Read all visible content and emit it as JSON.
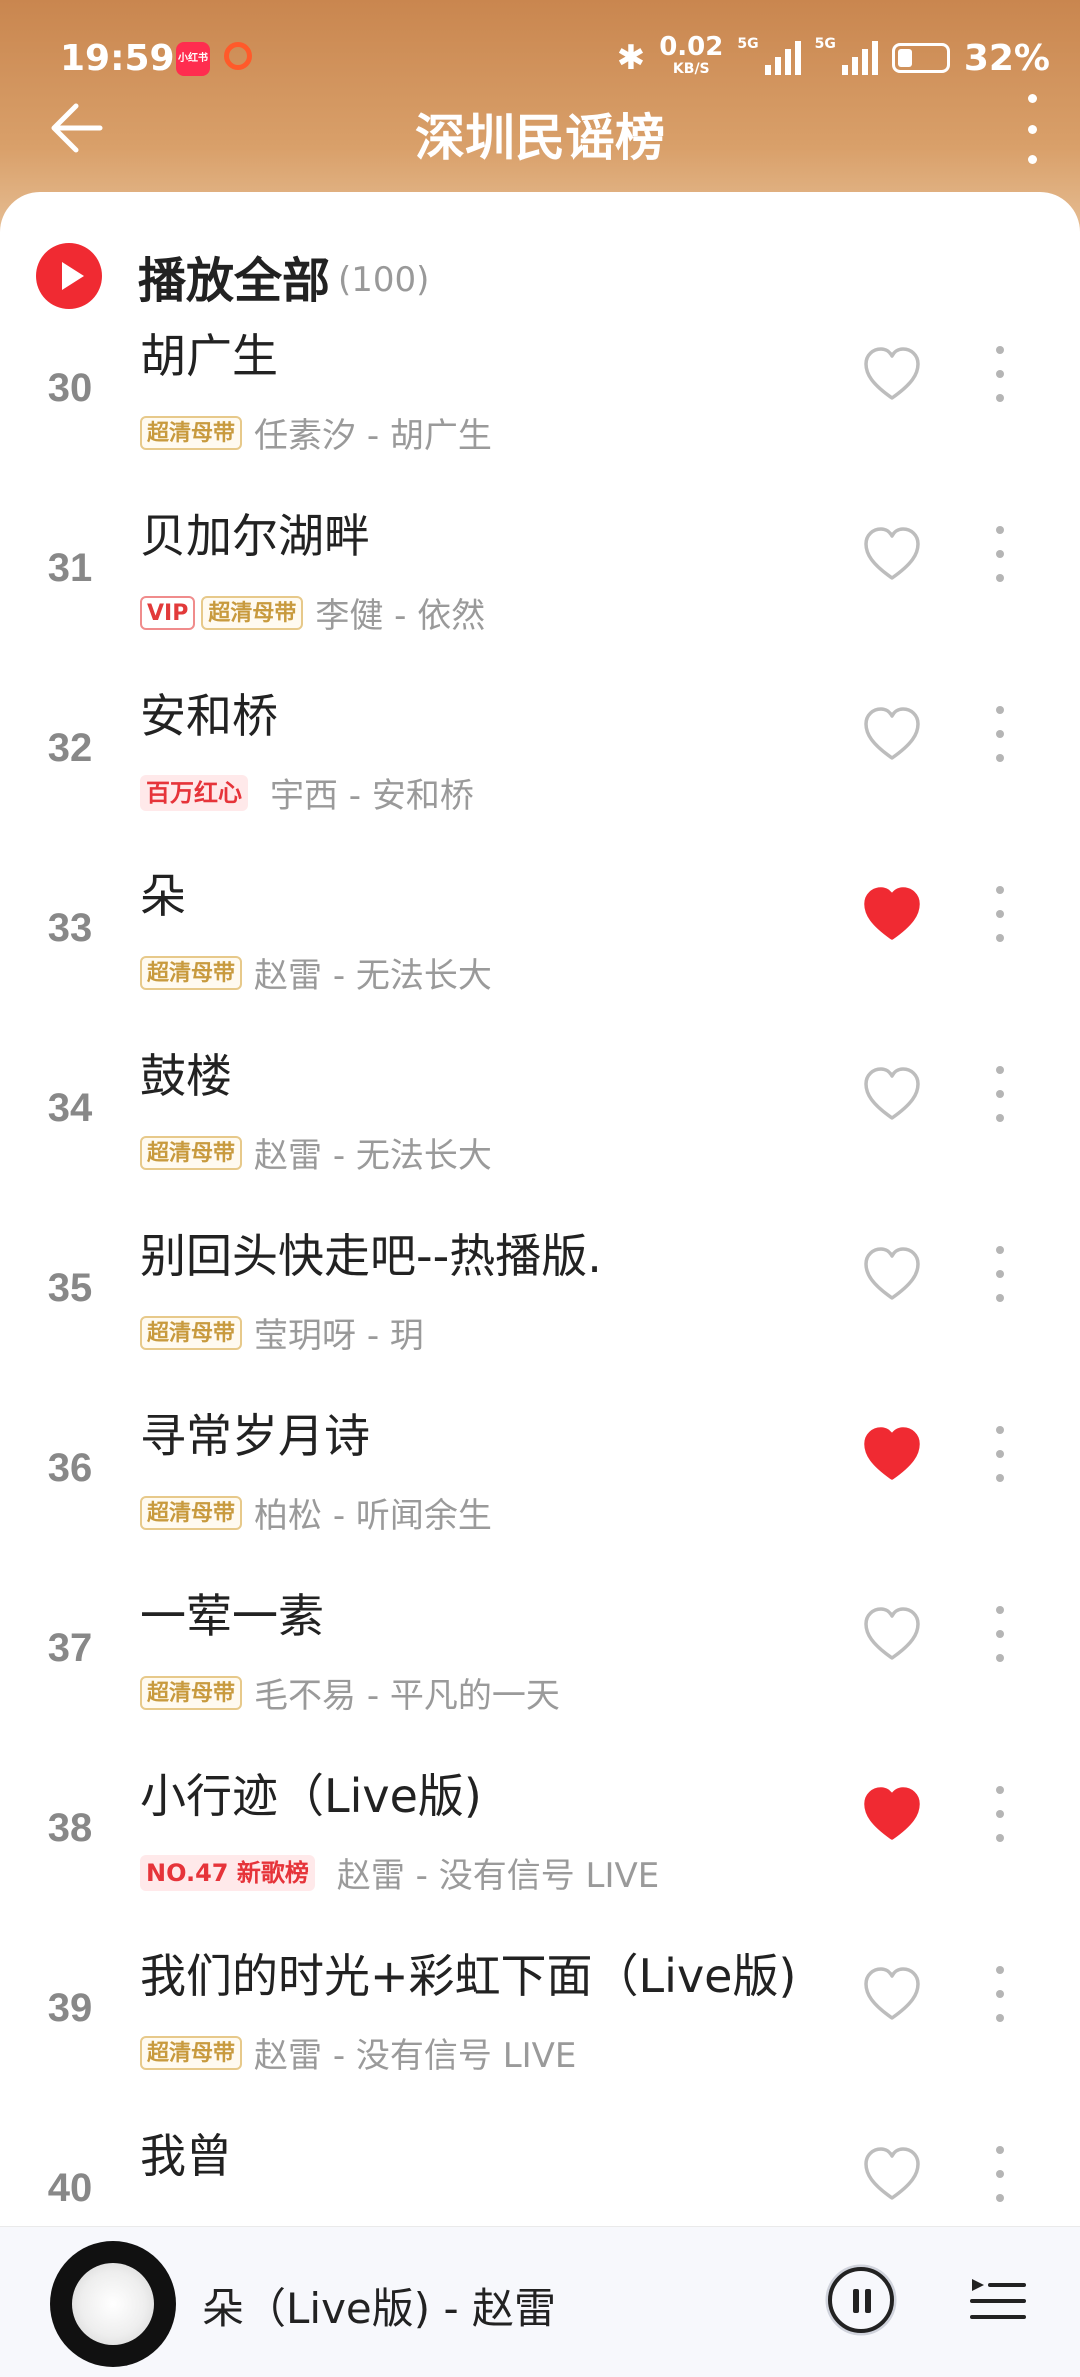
{
  "status": {
    "time": "19:59",
    "app_badge": "小红书",
    "speed": "0.02",
    "speed_unit": "KB/S",
    "net1": "5G",
    "net2": "5G",
    "battery": "32%"
  },
  "header": {
    "title": "深圳民谣榜"
  },
  "play_all": {
    "label": "播放全部",
    "count": "(100)"
  },
  "songs": [
    {
      "rank": "30",
      "title": "胡广生",
      "tags": [
        "超清母带"
      ],
      "artist": "任素汐 - 胡广生",
      "liked": false
    },
    {
      "rank": "31",
      "title": "贝加尔湖畔",
      "tags": [
        "VIP",
        "超清母带"
      ],
      "artist": "李健 - 依然",
      "liked": false
    },
    {
      "rank": "32",
      "title": "安和桥",
      "tags": [
        "百万红心"
      ],
      "artist": "宇西 - 安和桥",
      "liked": false
    },
    {
      "rank": "33",
      "title": "朵",
      "tags": [
        "超清母带"
      ],
      "artist": "赵雷 - 无法长大",
      "liked": true
    },
    {
      "rank": "34",
      "title": "鼓楼",
      "tags": [
        "超清母带"
      ],
      "artist": "赵雷 - 无法长大",
      "liked": false
    },
    {
      "rank": "35",
      "title": "别回头快走吧--热播版.",
      "tags": [
        "超清母带"
      ],
      "artist": "莹玥呀 - 玥",
      "liked": false
    },
    {
      "rank": "36",
      "title": "寻常岁月诗",
      "tags": [
        "超清母带"
      ],
      "artist": "柏松 - 听闻余生",
      "liked": true
    },
    {
      "rank": "37",
      "title": "一荤一素",
      "tags": [
        "超清母带"
      ],
      "artist": "毛不易 - 平凡的一天",
      "liked": false
    },
    {
      "rank": "38",
      "title": "小行迹（Live版)",
      "tags": [
        "NO.47 新歌榜"
      ],
      "artist": "赵雷 - 没有信号 LIVE",
      "liked": true
    },
    {
      "rank": "39",
      "title": "我们的时光+彩虹下面（Live版)",
      "tags": [
        "超清母带"
      ],
      "artist": "赵雷 - 没有信号 LIVE",
      "liked": false
    },
    {
      "rank": "40",
      "title": "我曾",
      "tags": [],
      "artist": "",
      "liked": false
    }
  ],
  "player": {
    "now_playing": "朵（Live版) - 赵雷"
  },
  "colors": {
    "accent": "#f02a32",
    "heart_liked": "#f02a32",
    "heart_empty": "#bdbdbd"
  }
}
